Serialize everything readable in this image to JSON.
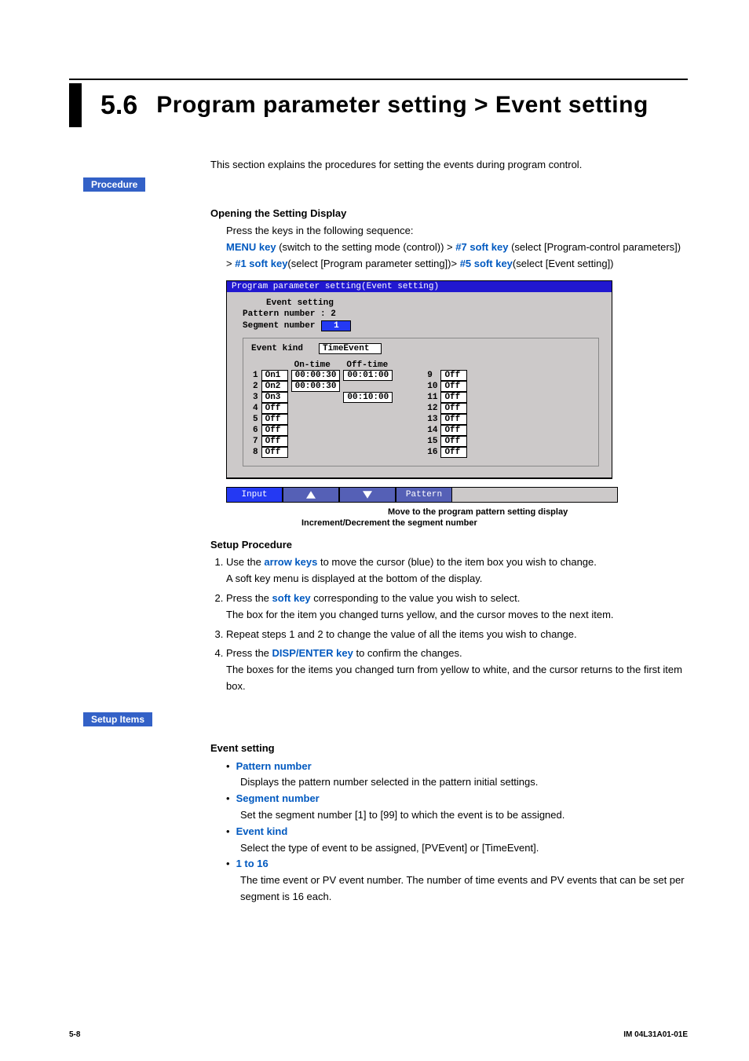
{
  "section": {
    "number": "5.6",
    "title": "Program parameter setting > Event setting"
  },
  "intro": "This section explains the procedures for setting the events during program control.",
  "tags": {
    "procedure": "Procedure",
    "setup_items": "Setup Items"
  },
  "opening": {
    "heading": "Opening the Setting Display",
    "lead": "Press the keys in the following sequence:",
    "seq": {
      "k1": "MENU key",
      "t1": " (switch to the setting mode (control)) > ",
      "k2": "#7 soft key",
      "t2": " (select [Program-control parameters])   > ",
      "k3": "#1 soft key",
      "t3": "(select [Program parameter setting])> ",
      "k4": "#5 soft key",
      "t4": "(select [Event setting])"
    }
  },
  "screenshot": {
    "titlebar": "Program parameter setting(Event setting)",
    "event_setting_label": "Event setting",
    "pattern_label": "Pattern number :  2",
    "segment_label": "Segment number",
    "segment_value": "1",
    "event_kind_label": "Event kind",
    "event_kind_value": "TimeEvent",
    "time_headers": {
      "on": "On-time",
      "off": "Off-time"
    },
    "left_rows": [
      {
        "n": "1",
        "state": "On1",
        "on": "00:00:30",
        "off": "00:01:00"
      },
      {
        "n": "2",
        "state": "On2",
        "on": "00:00:30",
        "off": ""
      },
      {
        "n": "3",
        "state": "On3",
        "on": "",
        "off": "00:10:00"
      },
      {
        "n": "4",
        "state": "Off",
        "on": "",
        "off": ""
      },
      {
        "n": "5",
        "state": "Off",
        "on": "",
        "off": ""
      },
      {
        "n": "6",
        "state": "Off",
        "on": "",
        "off": ""
      },
      {
        "n": "7",
        "state": "Off",
        "on": "",
        "off": ""
      },
      {
        "n": "8",
        "state": "Off",
        "on": "",
        "off": ""
      }
    ],
    "right_rows": [
      {
        "n": "9",
        "state": "Off"
      },
      {
        "n": "10",
        "state": "Off"
      },
      {
        "n": "11",
        "state": "Off"
      },
      {
        "n": "12",
        "state": "Off"
      },
      {
        "n": "13",
        "state": "Off"
      },
      {
        "n": "14",
        "state": "Off"
      },
      {
        "n": "15",
        "state": "Off"
      },
      {
        "n": "16",
        "state": "Off"
      }
    ]
  },
  "softkeys": {
    "k1": "Input",
    "k4": "Pattern"
  },
  "annotations": {
    "a1": "Move to the program pattern setting display",
    "a2": "Increment/Decrement the segment number"
  },
  "setup": {
    "heading": "Setup Procedure",
    "steps": {
      "s1a": "Use the ",
      "s1k": "arrow keys",
      "s1b": " to move the cursor (blue) to the item box you wish to change.",
      "s1c": "A soft key menu is displayed at the bottom of the display.",
      "s2a": "Press the ",
      "s2k": "soft key",
      "s2b": " corresponding to the value you wish to select.",
      "s2c": "The box for the item you changed turns yellow, and the cursor moves to the next item.",
      "s3": "Repeat steps 1 and 2 to change the value of all the items you wish to change.",
      "s4a": "Press the ",
      "s4k": "DISP/ENTER key",
      "s4b": " to confirm the changes.",
      "s4c": "The boxes for the items you changed turn from yellow to white, and the cursor returns to the first item box."
    }
  },
  "items": {
    "heading": "Event setting",
    "pattern_number": {
      "label": "Pattern number",
      "text": "Displays the pattern number selected in the pattern initial settings."
    },
    "segment_number": {
      "label": "Segment number",
      "text": "Set the segment number [1] to [99] to which the event is to be assigned."
    },
    "event_kind": {
      "label": "Event kind",
      "text": "Select the type of event to be assigned, [PVEvent] or [TimeEvent]."
    },
    "one_to_16": {
      "label": "1 to 16",
      "text": "The time event or PV event number. The number of time events and PV events that can be set per segment is 16 each."
    }
  },
  "footer": {
    "page": "5-8",
    "doc": "IM 04L31A01-01E"
  }
}
